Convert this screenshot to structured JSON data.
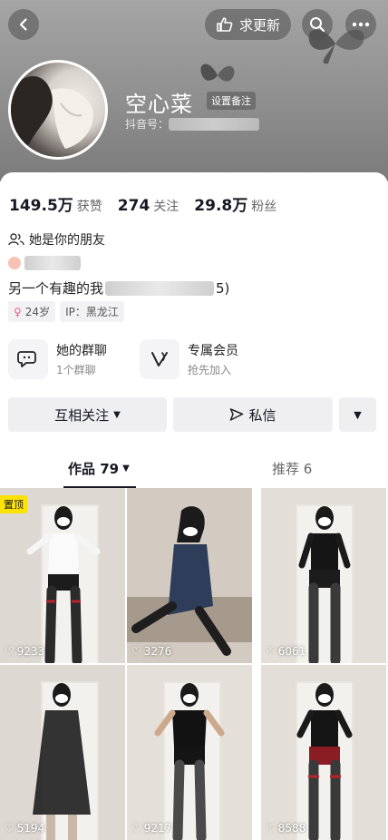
{
  "header": {
    "back_icon": "chevron-left-icon",
    "update_request_label": "求更新",
    "search_icon": "search-icon",
    "more_icon": "more-icon"
  },
  "profile": {
    "nickname": "空心菜",
    "remark_label": "设置备注",
    "id_prefix": "抖音号："
  },
  "stats": [
    {
      "value": "149.5万",
      "label": "获赞"
    },
    {
      "value": "274",
      "label": "关注"
    },
    {
      "value": "29.8万",
      "label": "粉丝"
    }
  ],
  "friend_status": "她是你的朋友",
  "bio_line2_prefix": "另一个有趣的我",
  "bio_line2_suffix": "5)",
  "tags": {
    "age": "24岁",
    "ip": "IP：黑龙江"
  },
  "features": [
    {
      "title": "她的群聊",
      "sub": "1个群聊"
    },
    {
      "title": "专属会员",
      "sub": "抢先加入"
    }
  ],
  "actions": {
    "follow_label": "互相关注",
    "message_label": "私信"
  },
  "tabs": {
    "works_label": "作品 79",
    "recommend_label": "推荐 6"
  },
  "pinned_label": "置顶",
  "videos": [
    {
      "likes": "9233"
    },
    {
      "likes": "3276"
    },
    {
      "likes": "6061"
    },
    {
      "likes": "5194"
    },
    {
      "likes": "9217"
    },
    {
      "likes": "8588"
    }
  ]
}
